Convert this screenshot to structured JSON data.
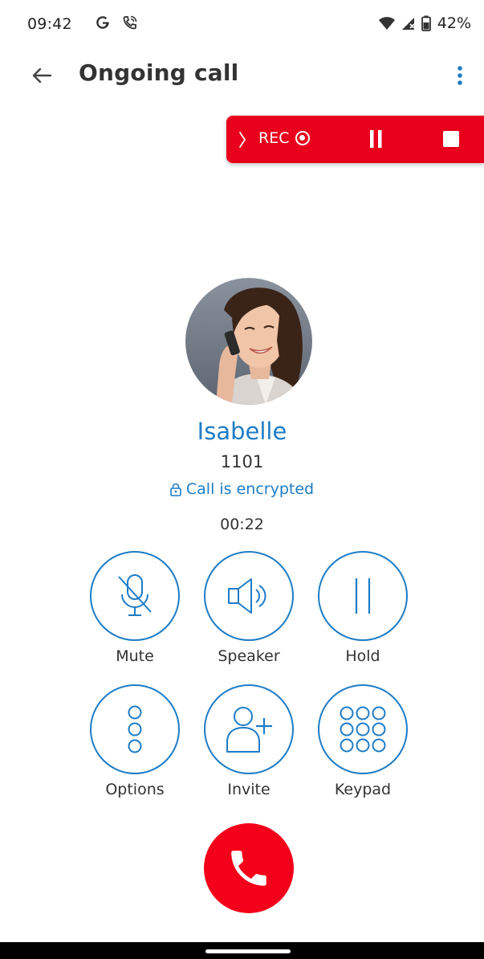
{
  "status_bar": {
    "time": "09:42",
    "left_icons": [
      "g-icon",
      "phone-call-icon"
    ],
    "right_icons": [
      "wifi-icon",
      "signal-icon",
      "battery-icon"
    ],
    "battery": "42%"
  },
  "app_bar": {
    "title": "Ongoing call",
    "back_icon": "arrow-left-icon",
    "menu_icon": "more-vertical-icon"
  },
  "recording": {
    "label": "REC",
    "color": "#e8001c",
    "controls": [
      "expand-chevron-icon",
      "record-indicator-icon",
      "pause-icon",
      "stop-icon"
    ]
  },
  "contact": {
    "name": "Isabelle",
    "extension": "1101",
    "encryption": "Call is encrypted",
    "duration": "00:22"
  },
  "actions": [
    {
      "label": "Mute",
      "icon": "mic-off-icon"
    },
    {
      "label": "Speaker",
      "icon": "speaker-icon"
    },
    {
      "label": "Hold",
      "icon": "pause-icon"
    },
    {
      "label": "Options",
      "icon": "more-vertical-icon"
    },
    {
      "label": "Invite",
      "icon": "add-user-icon"
    },
    {
      "label": "Keypad",
      "icon": "dialpad-icon"
    }
  ],
  "end_call": {
    "icon": "phone-hangup-icon",
    "color": "#f4001a"
  },
  "colors": {
    "accent": "#1e7cc6",
    "danger": "#f4001a",
    "text": "#333333"
  }
}
